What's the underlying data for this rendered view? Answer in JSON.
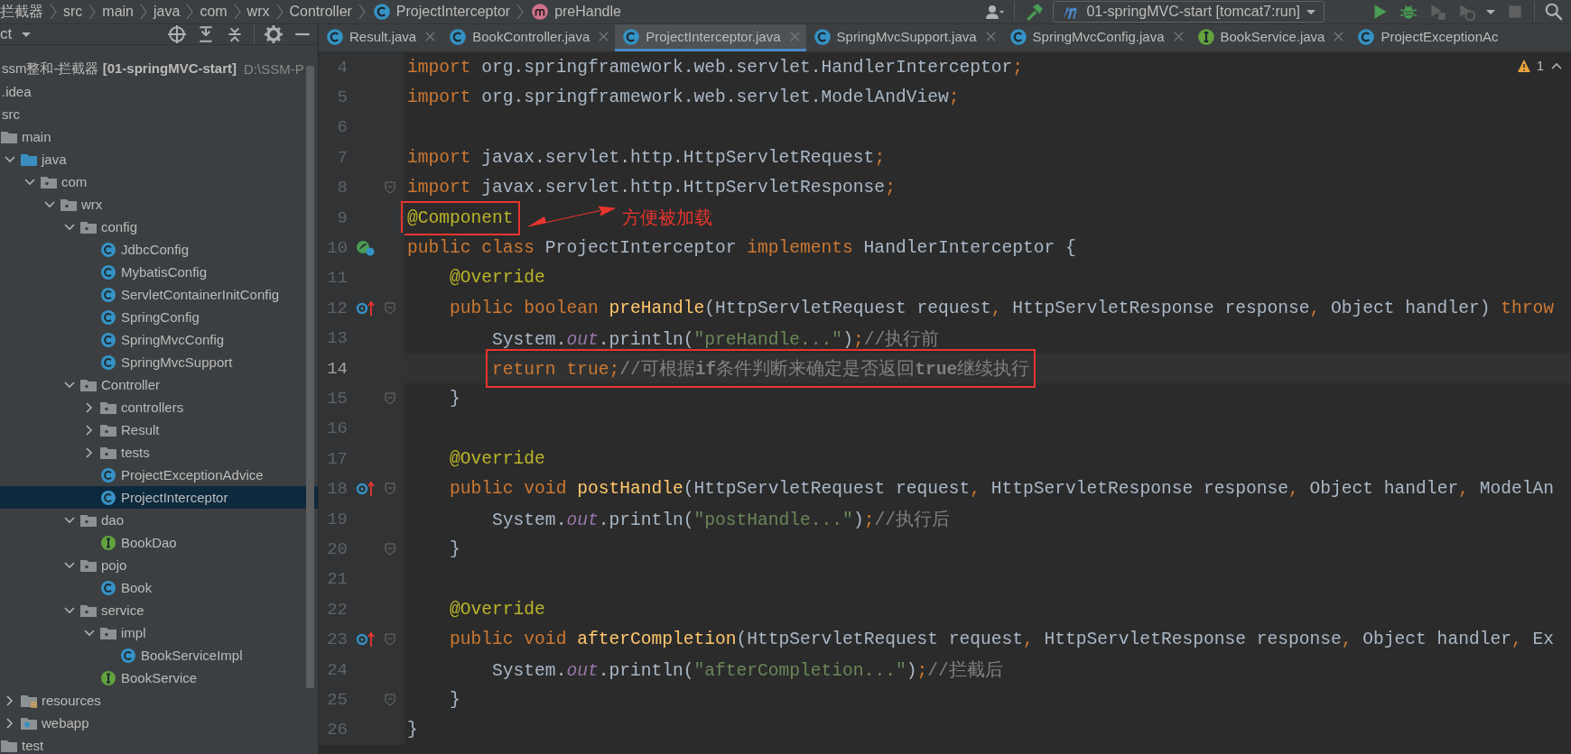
{
  "breadcrumb": [
    {
      "text": "拦截器"
    },
    {
      "text": "src"
    },
    {
      "text": "main"
    },
    {
      "text": "java"
    },
    {
      "text": "com"
    },
    {
      "text": "wrx"
    },
    {
      "text": "Controller"
    },
    {
      "text": "ProjectInterceptor",
      "kind": "class"
    },
    {
      "text": "preHandle",
      "kind": "method"
    }
  ],
  "toolbar": {
    "run_config": "01-springMVC-start [tomcat7:run]"
  },
  "project_panel": {
    "title": "ct",
    "tree": [
      {
        "label": "ssm整和-拦截器 **[01-springMVC-start]**",
        "path": "D:\\SSM-P",
        "kind": "module",
        "selected": false,
        "children": [
          {
            "label": ".idea",
            "selected": false
          },
          {
            "label": "src",
            "selected": false,
            "children": [
              {
                "label": "main",
                "kind": "folder",
                "selected": false,
                "children": [
                  {
                    "label": "java",
                    "kind": "source",
                    "expanded": true,
                    "selected": false,
                    "children": [
                      {
                        "label": "com",
                        "kind": "package",
                        "expanded": true,
                        "selected": false,
                        "children": [
                          {
                            "label": "wrx",
                            "kind": "package",
                            "expanded": true,
                            "selected": false,
                            "children": [
                              {
                                "label": "config",
                                "kind": "package",
                                "expanded": true,
                                "selected": false,
                                "children": [
                                  {
                                    "label": "JdbcConfig",
                                    "kind": "class",
                                    "selected": false
                                  },
                                  {
                                    "label": "MybatisConfig",
                                    "kind": "class",
                                    "selected": false
                                  },
                                  {
                                    "label": "ServletContainerInitConfig",
                                    "kind": "class",
                                    "selected": false
                                  },
                                  {
                                    "label": "SpringConfig",
                                    "kind": "class",
                                    "selected": false
                                  },
                                  {
                                    "label": "SpringMvcConfig",
                                    "kind": "class",
                                    "selected": false
                                  },
                                  {
                                    "label": "SpringMvcSupport",
                                    "kind": "class",
                                    "selected": false
                                  }
                                ]
                              },
                              {
                                "label": "Controller",
                                "kind": "package",
                                "expanded": true,
                                "selected": false,
                                "children": [
                                  {
                                    "label": "controllers",
                                    "kind": "package",
                                    "expanded": false,
                                    "selected": false
                                  },
                                  {
                                    "label": "Result",
                                    "kind": "package",
                                    "expanded": false,
                                    "selected": false
                                  },
                                  {
                                    "label": "tests",
                                    "kind": "package",
                                    "expanded": false,
                                    "selected": false
                                  },
                                  {
                                    "label": "ProjectExceptionAdvice",
                                    "kind": "class",
                                    "selected": false
                                  },
                                  {
                                    "label": "ProjectInterceptor",
                                    "kind": "class",
                                    "selected": true
                                  }
                                ]
                              },
                              {
                                "label": "dao",
                                "kind": "package",
                                "expanded": true,
                                "selected": false,
                                "children": [
                                  {
                                    "label": "BookDao",
                                    "kind": "interface",
                                    "selected": false
                                  }
                                ]
                              },
                              {
                                "label": "pojo",
                                "kind": "package",
                                "expanded": true,
                                "selected": false,
                                "children": [
                                  {
                                    "label": "Book",
                                    "kind": "class",
                                    "selected": false
                                  }
                                ]
                              },
                              {
                                "label": "service",
                                "kind": "package",
                                "expanded": true,
                                "selected": false,
                                "children": [
                                  {
                                    "label": "impl",
                                    "kind": "package",
                                    "expanded": true,
                                    "selected": false,
                                    "children": [
                                      {
                                        "label": "BookServiceImpl",
                                        "kind": "class",
                                        "selected": false
                                      }
                                    ]
                                  },
                                  {
                                    "label": "BookService",
                                    "kind": "interface",
                                    "selected": false
                                  }
                                ]
                              }
                            ]
                          }
                        ]
                      }
                    ]
                  },
                  {
                    "label": "resources",
                    "kind": "resources",
                    "expanded": false,
                    "selected": false
                  },
                  {
                    "label": "webapp",
                    "kind": "webapp",
                    "expanded": false,
                    "selected": false
                  }
                ]
              },
              {
                "label": "test",
                "kind": "folder",
                "selected": false
              }
            ]
          }
        ]
      }
    ]
  },
  "tabs": [
    {
      "label": "Result.java",
      "kind": "class",
      "selected": false
    },
    {
      "label": "BookController.java",
      "kind": "class",
      "selected": false
    },
    {
      "label": "ProjectInterceptor.java",
      "kind": "class",
      "selected": true
    },
    {
      "label": "SpringMvcSupport.java",
      "kind": "class",
      "selected": false
    },
    {
      "label": "SpringMvcConfig.java",
      "kind": "class",
      "selected": false
    },
    {
      "label": "BookService.java",
      "kind": "interface",
      "selected": false
    },
    {
      "label": "ProjectExceptionAc",
      "kind": "class",
      "selected": false
    }
  ],
  "editor": {
    "warning_count": "1",
    "lines": [
      {
        "number": "4",
        "kind": "plain",
        "current": false,
        "fold": false,
        "boxed": false,
        "tokens": [
          {
            "kind": "keyword",
            "text": "import"
          },
          {
            "kind": "plain",
            "text": " org.springframework.web.servlet.HandlerInterceptor"
          },
          {
            "kind": "keyword",
            "text": ";"
          }
        ]
      },
      {
        "number": "5",
        "kind": "plain",
        "current": false,
        "fold": false,
        "boxed": false,
        "tokens": [
          {
            "kind": "keyword",
            "text": "import"
          },
          {
            "kind": "plain",
            "text": " org.springframework.web.servlet.ModelAndView"
          },
          {
            "kind": "keyword",
            "text": ";"
          }
        ]
      },
      {
        "number": "6",
        "kind": "plain",
        "current": false,
        "fold": false
      },
      {
        "number": "7",
        "kind": "plain",
        "current": false,
        "fold": false,
        "boxed": false,
        "tokens": [
          {
            "kind": "keyword",
            "text": "import"
          },
          {
            "kind": "plain",
            "text": " javax.servlet.http.HttpServletRequest"
          },
          {
            "kind": "keyword",
            "text": ";"
          }
        ]
      },
      {
        "number": "8",
        "kind": "plain",
        "current": false,
        "fold": true,
        "boxed": false,
        "tokens": [
          {
            "kind": "keyword",
            "text": "import"
          },
          {
            "kind": "plain",
            "text": " javax.servlet.http.HttpServletResponse"
          },
          {
            "kind": "keyword",
            "text": ";"
          }
        ]
      },
      {
        "number": "9",
        "kind": "plain",
        "current": false,
        "fold": false,
        "boxed": true,
        "callout": "方便被加载",
        "tokens": [
          {
            "kind": "annotation",
            "text": "@Component"
          }
        ]
      },
      {
        "number": "10",
        "kind": "bean",
        "current": false,
        "fold": false,
        "boxed": false,
        "tokens": [
          {
            "kind": "keyword",
            "text": "public class "
          },
          {
            "kind": "plain",
            "text": "ProjectInterceptor "
          },
          {
            "kind": "keyword",
            "text": "implements "
          },
          {
            "kind": "plain",
            "text": "HandlerInterceptor {"
          }
        ]
      },
      {
        "number": "11",
        "kind": "plain",
        "current": false,
        "fold": false,
        "boxed": false,
        "tokens": [
          {
            "kind": "annotation",
            "text": "    @Override"
          }
        ]
      },
      {
        "number": "12",
        "kind": "override",
        "current": false,
        "fold": true,
        "boxed": false,
        "tokens": [
          {
            "kind": "keyword",
            "text": "    public boolean "
          },
          {
            "kind": "declaration",
            "text": "preHandle"
          },
          {
            "kind": "plain",
            "text": "(HttpServletRequest request"
          },
          {
            "kind": "keyword",
            "text": ", "
          },
          {
            "kind": "plain",
            "text": "HttpServletResponse response"
          },
          {
            "kind": "keyword",
            "text": ", "
          },
          {
            "kind": "plain",
            "text": "Object handler) "
          },
          {
            "kind": "keyword",
            "text": "throw"
          }
        ]
      },
      {
        "number": "13",
        "kind": "plain",
        "current": false,
        "fold": false,
        "boxed": false,
        "tokens": [
          {
            "kind": "plain",
            "text": "        System."
          },
          {
            "kind": "static",
            "text": "out"
          },
          {
            "kind": "plain",
            "text": ".println("
          },
          {
            "kind": "string",
            "text": "\"preHandle...\""
          },
          {
            "kind": "plain",
            "text": ")"
          },
          {
            "kind": "keyword",
            "text": ";"
          },
          {
            "kind": "comment",
            "text": "//执行前"
          }
        ]
      },
      {
        "number": "14",
        "kind": "plain",
        "current": true,
        "fold": false,
        "boxed": true,
        "tokens": [
          {
            "kind": "keyword",
            "text": "        return true;"
          },
          {
            "kind": "comment",
            "text": "//可根据**if**条件判断来确定是否返回**true**继续执行"
          }
        ]
      },
      {
        "number": "15",
        "kind": "plain",
        "current": false,
        "fold": true,
        "boxed": false,
        "tokens": [
          {
            "kind": "plain",
            "text": "    }"
          }
        ]
      },
      {
        "number": "16",
        "kind": "plain",
        "current": false,
        "fold": false
      },
      {
        "number": "17",
        "kind": "plain",
        "current": false,
        "fold": false,
        "boxed": false,
        "tokens": [
          {
            "kind": "annotation",
            "text": "    @Override"
          }
        ]
      },
      {
        "number": "18",
        "kind": "override",
        "current": false,
        "fold": true,
        "boxed": false,
        "tokens": [
          {
            "kind": "keyword",
            "text": "    public void "
          },
          {
            "kind": "declaration",
            "text": "postHandle"
          },
          {
            "kind": "plain",
            "text": "(HttpServletRequest request"
          },
          {
            "kind": "keyword",
            "text": ", "
          },
          {
            "kind": "plain",
            "text": "HttpServletResponse response"
          },
          {
            "kind": "keyword",
            "text": ", "
          },
          {
            "kind": "plain",
            "text": "Object handler"
          },
          {
            "kind": "keyword",
            "text": ", "
          },
          {
            "kind": "plain",
            "text": "ModelAn"
          }
        ]
      },
      {
        "number": "19",
        "kind": "plain",
        "current": false,
        "fold": false,
        "boxed": false,
        "tokens": [
          {
            "kind": "plain",
            "text": "        System."
          },
          {
            "kind": "static",
            "text": "out"
          },
          {
            "kind": "plain",
            "text": ".println("
          },
          {
            "kind": "string",
            "text": "\"postHandle...\""
          },
          {
            "kind": "plain",
            "text": ")"
          },
          {
            "kind": "keyword",
            "text": ";"
          },
          {
            "kind": "comment",
            "text": "//执行后"
          }
        ]
      },
      {
        "number": "20",
        "kind": "plain",
        "current": false,
        "fold": true,
        "boxed": false,
        "tokens": [
          {
            "kind": "plain",
            "text": "    }"
          }
        ]
      },
      {
        "number": "21",
        "kind": "plain",
        "current": false,
        "fold": false
      },
      {
        "number": "22",
        "kind": "plain",
        "current": false,
        "fold": false,
        "boxed": false,
        "tokens": [
          {
            "kind": "annotation",
            "text": "    @Override"
          }
        ]
      },
      {
        "number": "23",
        "kind": "override",
        "current": false,
        "fold": true,
        "boxed": false,
        "tokens": [
          {
            "kind": "keyword",
            "text": "    public void "
          },
          {
            "kind": "declaration",
            "text": "afterCompletion"
          },
          {
            "kind": "plain",
            "text": "(HttpServletRequest request"
          },
          {
            "kind": "keyword",
            "text": ", "
          },
          {
            "kind": "plain",
            "text": "HttpServletResponse response"
          },
          {
            "kind": "keyword",
            "text": ", "
          },
          {
            "kind": "plain",
            "text": "Object handler"
          },
          {
            "kind": "keyword",
            "text": ", "
          },
          {
            "kind": "plain",
            "text": "Ex"
          }
        ]
      },
      {
        "number": "24",
        "kind": "plain",
        "current": false,
        "fold": false,
        "boxed": false,
        "tokens": [
          {
            "kind": "plain",
            "text": "        System."
          },
          {
            "kind": "static",
            "text": "out"
          },
          {
            "kind": "plain",
            "text": ".println("
          },
          {
            "kind": "string",
            "text": "\"afterCompletion...\""
          },
          {
            "kind": "plain",
            "text": ")"
          },
          {
            "kind": "keyword",
            "text": ";"
          },
          {
            "kind": "comment",
            "text": "//拦截后"
          }
        ]
      },
      {
        "number": "25",
        "kind": "plain",
        "current": false,
        "fold": true,
        "boxed": false,
        "tokens": [
          {
            "kind": "plain",
            "text": "    }"
          }
        ]
      },
      {
        "number": "26",
        "kind": "plain",
        "current": false,
        "fold": false,
        "boxed": false,
        "tokens": [
          {
            "kind": "plain",
            "text": "}"
          }
        ]
      }
    ]
  }
}
